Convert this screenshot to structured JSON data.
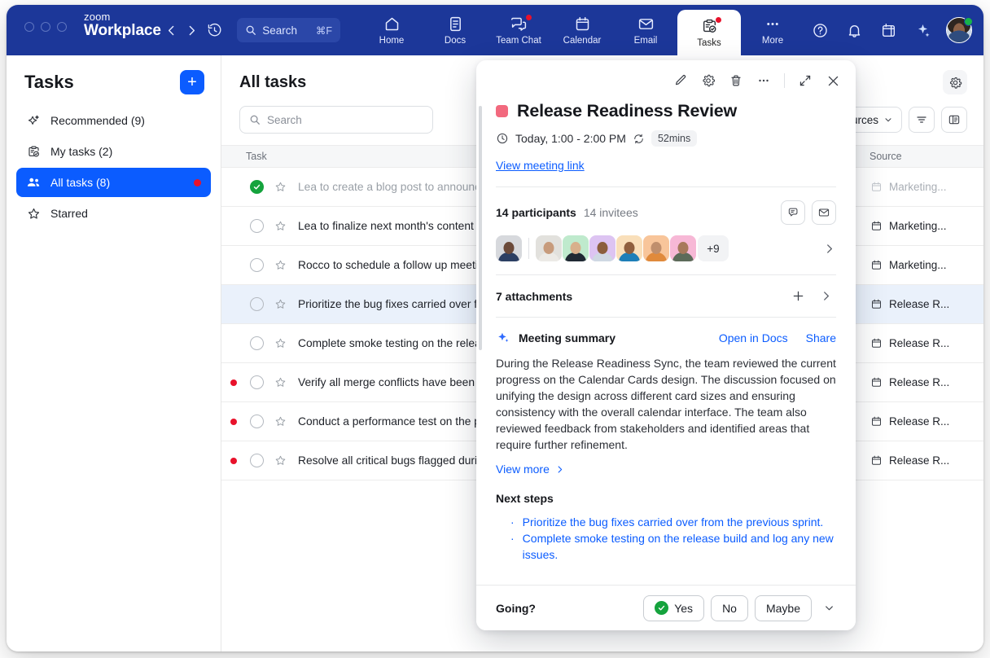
{
  "app": {
    "brand_top": "zoom",
    "brand_bottom": "Workplace",
    "search_placeholder": "Search",
    "search_shortcut": "⌘F"
  },
  "topnav": {
    "items": [
      {
        "label": "Home",
        "icon": "home-icon",
        "badge": false,
        "active": false
      },
      {
        "label": "Docs",
        "icon": "docs-icon",
        "badge": false,
        "active": false
      },
      {
        "label": "Team Chat",
        "icon": "team-chat-icon",
        "badge": true,
        "active": false
      },
      {
        "label": "Calendar",
        "icon": "calendar-icon",
        "badge": false,
        "active": false
      },
      {
        "label": "Email",
        "icon": "email-icon",
        "badge": false,
        "active": false
      },
      {
        "label": "Tasks",
        "icon": "tasks-icon",
        "badge": true,
        "active": true
      },
      {
        "label": "More",
        "icon": "ellipsis-icon",
        "badge": false,
        "active": false
      }
    ],
    "right_icons": [
      "help-icon",
      "bell-icon",
      "calendar-day-icon",
      "ai-sparkle-icon"
    ],
    "avatar": {
      "name": "user-avatar",
      "status": "online",
      "status_color": "#16b34a"
    }
  },
  "sidebar": {
    "title": "Tasks",
    "add_label": "+",
    "items": [
      {
        "label": "Recommended (9)",
        "icon": "sparkle-icon",
        "active": false,
        "badge": false
      },
      {
        "label": "My tasks (2)",
        "icon": "clipboard-check-icon",
        "active": false,
        "badge": false
      },
      {
        "label": "All tasks (8)",
        "icon": "people-icon",
        "active": true,
        "badge": true
      },
      {
        "label": "Starred",
        "icon": "star-icon",
        "active": false,
        "badge": false
      }
    ]
  },
  "main": {
    "title": "All tasks",
    "settings_icon": "gear-icon",
    "search_placeholder": "Search",
    "sources_filter_label": "All sources",
    "filter_icon": "filter-icon",
    "layout_icon": "panel-layout-icon",
    "columns": {
      "task": "Task",
      "source": "Source"
    },
    "rows": [
      {
        "flag": false,
        "done": true,
        "starred": false,
        "task": "Lea to create a blog post to announce the new launch",
        "source": "Marketing...",
        "selected": false
      },
      {
        "flag": false,
        "done": false,
        "starred": false,
        "task": "Lea to finalize next month's content calendar",
        "source": "Marketing...",
        "selected": false
      },
      {
        "flag": false,
        "done": false,
        "starred": false,
        "task": "Rocco to schedule a follow up meeting with the team to review launch plans",
        "source": "Marketing...",
        "selected": false
      },
      {
        "flag": false,
        "done": false,
        "starred": false,
        "task": "Prioritize the bug fixes carried over from the previous sprint.",
        "source": "Release R...",
        "selected": true
      },
      {
        "flag": false,
        "done": false,
        "starred": false,
        "task": "Complete smoke testing on the release build and log any new issues.",
        "source": "Release R...",
        "selected": false
      },
      {
        "flag": true,
        "done": false,
        "starred": false,
        "task": "Verify all merge conflicts have been resolved in the release branch.",
        "source": "Release R...",
        "selected": false
      },
      {
        "flag": true,
        "done": false,
        "starred": false,
        "task": "Conduct a performance test on the payment module to ensure stability.",
        "source": "Release R...",
        "selected": false
      },
      {
        "flag": true,
        "done": false,
        "starred": false,
        "task": "Resolve all critical bugs flagged during the regression testing.",
        "source": "Release R...",
        "selected": false
      }
    ]
  },
  "panel": {
    "toolbar_icons": [
      "edit-pencil-icon",
      "gear-icon",
      "trash-icon",
      "more-ellipsis-icon",
      "expand-icon",
      "close-icon"
    ],
    "color_swatch": "#f2697e",
    "title": "Release Readiness Review",
    "time": "Today, 1:00 - 2:00 PM",
    "recurring_icon": "recurring-icon",
    "duration_badge": "52mins",
    "meeting_link_label": "View meeting link",
    "participants": {
      "count_label": "14 participants",
      "invitees_label": "14 invitees",
      "chat_icon": "chat-bubble-icon",
      "email_icon": "envelope-icon",
      "overflow_label": "+9",
      "chevron_icon": "chevron-right-icon",
      "avatar_colors": [
        "#d7d9dd",
        "#e2e1dd",
        "#bfeacd",
        "#ddc4f2",
        "#f9dfba",
        "#f8c59a",
        "#f7b8d6"
      ]
    },
    "attachments": {
      "label": "7 attachments",
      "add_icon": "plus-icon",
      "chevron_icon": "chevron-right-icon"
    },
    "summary": {
      "icon": "ai-sparkle-icon",
      "title": "Meeting summary",
      "open_in_docs": "Open in Docs",
      "share": "Share",
      "text": "During the Release Readiness Sync, the team reviewed the current progress on the Calendar Cards design. The discussion focused on unifying the design across different card sizes and ensuring consistency with the overall calendar interface. The team also reviewed feedback from stakeholders and identified areas that require further refinement.",
      "view_more": "View more"
    },
    "next_steps": {
      "title": "Next steps",
      "items": [
        "Prioritize the bug fixes carried over from the previous sprint.",
        "Complete smoke testing on the release build and log any new issues."
      ]
    },
    "rsvp": {
      "question": "Going?",
      "yes": "Yes",
      "no": "No",
      "maybe": "Maybe",
      "selected": "Yes",
      "chevron_icon": "chevron-down-icon"
    }
  }
}
